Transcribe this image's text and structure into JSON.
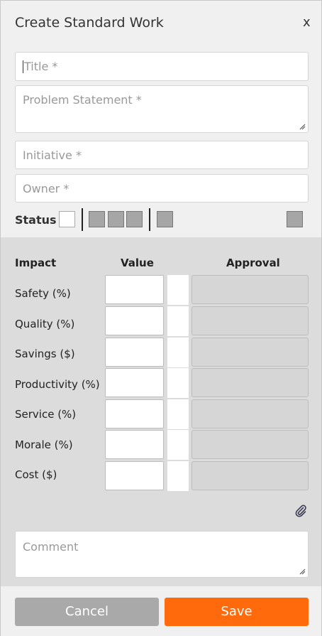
{
  "dialog": {
    "title": "Create Standard Work",
    "close_label": "x"
  },
  "form": {
    "title_placeholder": "Title *",
    "problem_placeholder": "Problem Statement *",
    "initiative_placeholder": "Initiative *",
    "owner_placeholder": "Owner *",
    "comment_placeholder": "Comment"
  },
  "status": {
    "label": "Status",
    "indicators": [
      {
        "color": "#ffffff"
      },
      {
        "color": "#a6a6a6"
      },
      {
        "color": "#a6a6a6"
      },
      {
        "color": "#a6a6a6"
      },
      {
        "color": "#a6a6a6"
      },
      {
        "color": "#a6a6a6"
      }
    ]
  },
  "impact": {
    "headers": {
      "impact": "Impact",
      "value": "Value",
      "approval": "Approval"
    },
    "rows": [
      {
        "label": "Safety (%)",
        "value": "",
        "approval": ""
      },
      {
        "label": "Quality (%)",
        "value": "",
        "approval": ""
      },
      {
        "label": "Savings ($)",
        "value": "",
        "approval": ""
      },
      {
        "label": "Productivity (%)",
        "value": "",
        "approval": ""
      },
      {
        "label": "Service (%)",
        "value": "",
        "approval": ""
      },
      {
        "label": "Morale (%)",
        "value": "",
        "approval": ""
      },
      {
        "label": "Cost ($)",
        "value": "",
        "approval": ""
      }
    ]
  },
  "buttons": {
    "cancel_label": "Cancel",
    "save_label": "Save"
  },
  "colors": {
    "accent": "#ff6a0d",
    "cancel": "#a9a9a9",
    "section_bg": "#dcdcdc"
  },
  "icons": {
    "attach": "paperclip-icon",
    "close": "close-icon",
    "resize": "resize-handle-icon"
  }
}
